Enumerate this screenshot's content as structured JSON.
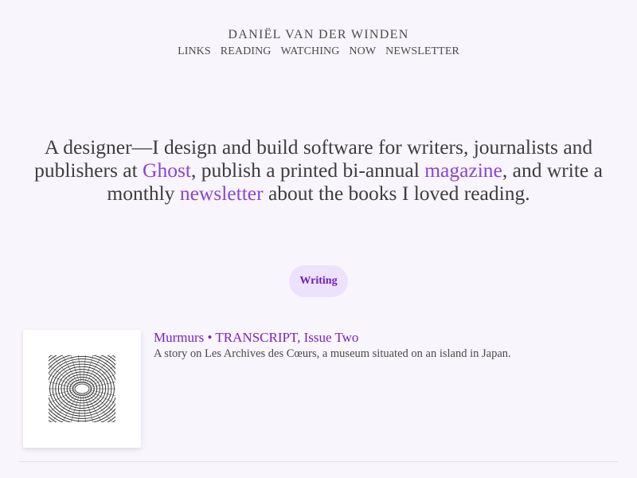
{
  "site": {
    "title": "DANIËL VAN DER WINDEN"
  },
  "nav": {
    "items": [
      "LINKS",
      "READING",
      "WATCHING",
      "NOW",
      "NEWSLETTER"
    ]
  },
  "intro": {
    "part1": "A designer—I design and build software for writers, journalists and publishers at ",
    "link1": "Ghost",
    "part2": ", publish a printed bi-annual ",
    "link2": "magazine",
    "part3": ", and write a monthly ",
    "link3": "newsletter",
    "part4": " about the books I loved reading."
  },
  "section": {
    "label": "Writing"
  },
  "posts": [
    {
      "title": "Murmurs • TRANSCRIPT, Issue Two",
      "description": "A story on Les Archives des Cœurs, a museum situated on an island in Japan."
    }
  ],
  "colors": {
    "background": "#f8f5fc",
    "accent": "#8a44d8",
    "pill_bg": "#ede2fb",
    "pill_text": "#6f1fb8"
  }
}
